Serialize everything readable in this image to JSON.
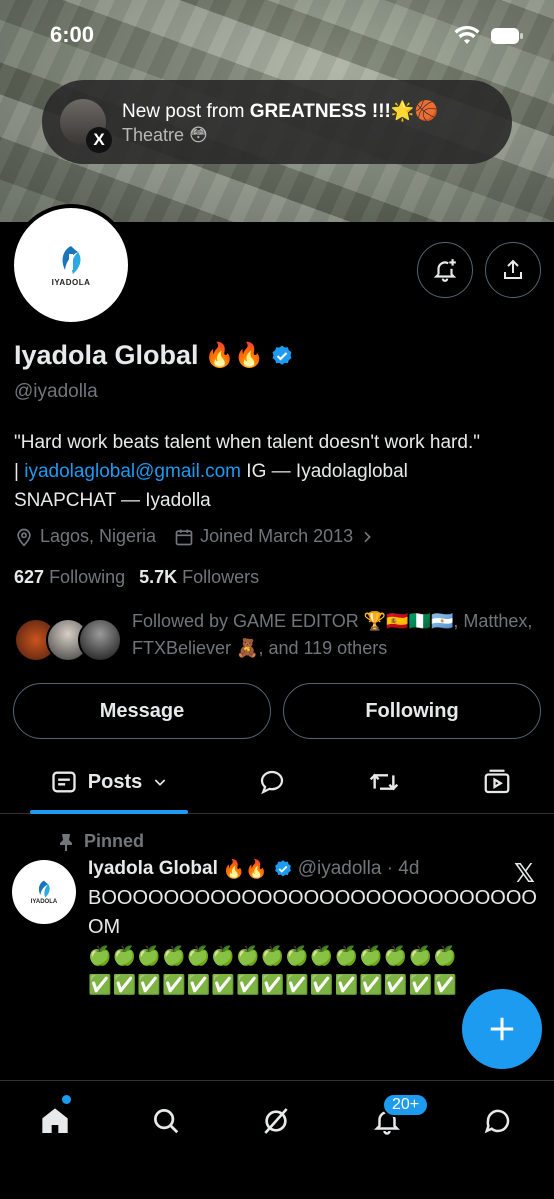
{
  "status_bar": {
    "time": "6:00"
  },
  "notification": {
    "title_prefix": "New post from ",
    "title_name": "GREATNESS !!!",
    "title_emoji": "🌟🏀",
    "subtitle": "Theatre 😳",
    "app_badge": "X"
  },
  "profile": {
    "avatar_logo_text": "IYADOLA",
    "name": "Iyadola Global",
    "name_emoji": "🔥🔥",
    "handle": "@iyadolla",
    "bio_line1": "\"Hard work beats talent when talent doesn't work hard.\"",
    "bio_sep": "| ",
    "bio_email": "iyadolaglobal@gmail.com",
    "bio_ig": " IG — Iyadolaglobal",
    "bio_snap": "SNAPCHAT — Iyadolla",
    "location": "Lagos, Nigeria",
    "joined": "Joined March 2013",
    "following_count": "627",
    "following_label": "Following",
    "followers_count": "5.7K",
    "followers_label": "Followers",
    "followed_by": "Followed by GAME EDITOR 🏆🇪🇸🇳🇬🇦🇷, Matthex, FTXBeliever 🧸, and 119 others"
  },
  "actions": {
    "message": "Message",
    "following": "Following"
  },
  "tabs": {
    "posts": "Posts"
  },
  "pinned_post": {
    "pinned_label": "Pinned",
    "author": "Iyadola Global",
    "author_emoji": "🔥🔥",
    "handle_time": "@iyadolla · 4d",
    "text": "BOOOOOOOOOOOOOOOOOOOOOOOOOOOOOM",
    "apples": "🍏🍏🍏🍏🍏🍏🍏🍏🍏🍏🍏🍏🍏🍏🍏",
    "checks": "✅✅✅✅✅✅✅✅✅✅✅✅✅✅✅"
  },
  "bottom_nav": {
    "notifications_badge": "20+"
  },
  "colors": {
    "accent": "#1d9bf0",
    "background": "#000000",
    "muted": "#71767b",
    "border": "#2f3336"
  },
  "icons": [
    "home-icon",
    "search-icon",
    "grok-icon",
    "bell-icon",
    "messages-icon",
    "share-icon",
    "bell-plus-icon",
    "location-icon",
    "calendar-icon",
    "pin-icon",
    "reply-icon",
    "repost-icon",
    "media-icon",
    "plus-icon",
    "verified-icon"
  ]
}
